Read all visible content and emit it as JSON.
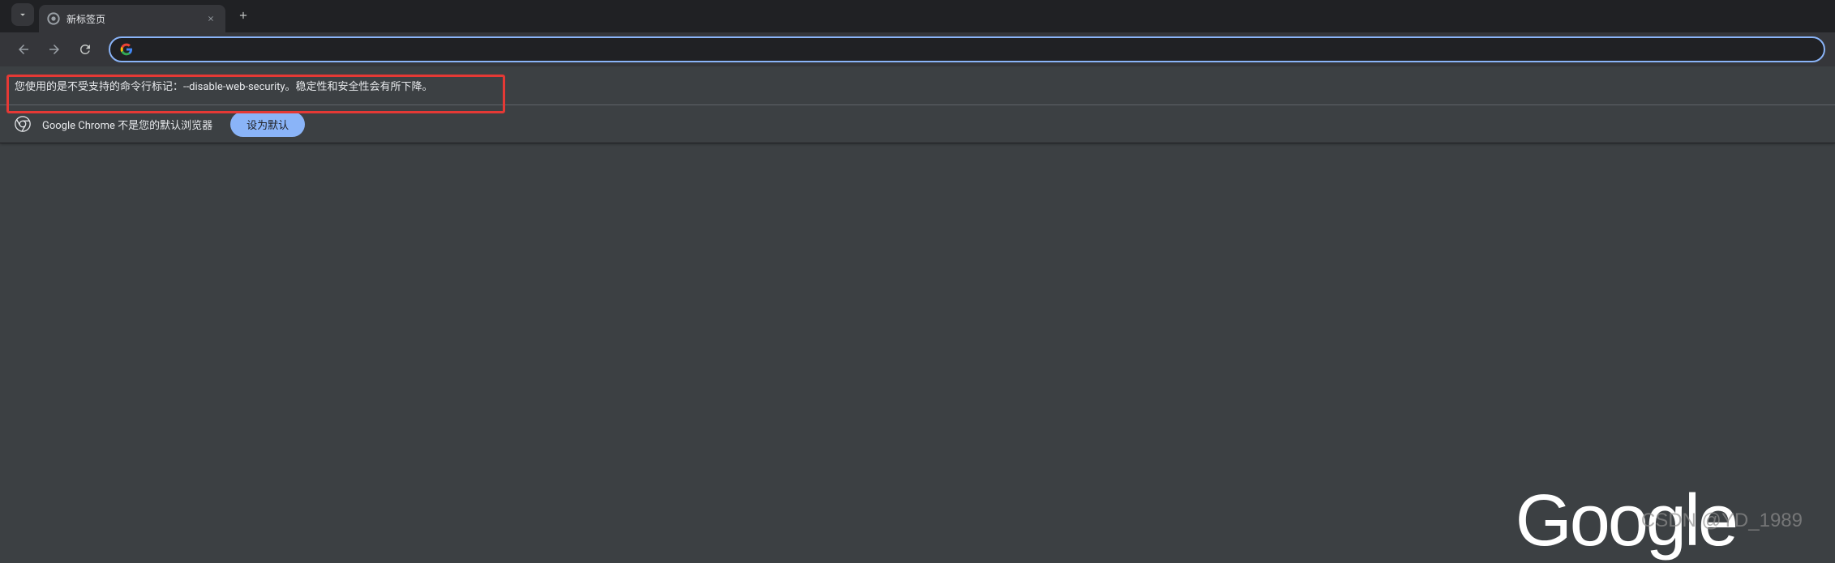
{
  "tab": {
    "title": "新标签页"
  },
  "omnibox": {
    "placeholder": ""
  },
  "warning": {
    "text": "您使用的是不受支持的命令行标记：--disable-web-security。稳定性和安全性会有所下降。"
  },
  "infobar": {
    "text": "Google Chrome 不是您的默认浏览器",
    "button": "设为默认"
  },
  "logo": {
    "text": "Google"
  },
  "watermark": {
    "text": "CSDN @YD_1989"
  },
  "colors": {
    "accent": "#8ab4f8",
    "highlight": "#e53935"
  }
}
